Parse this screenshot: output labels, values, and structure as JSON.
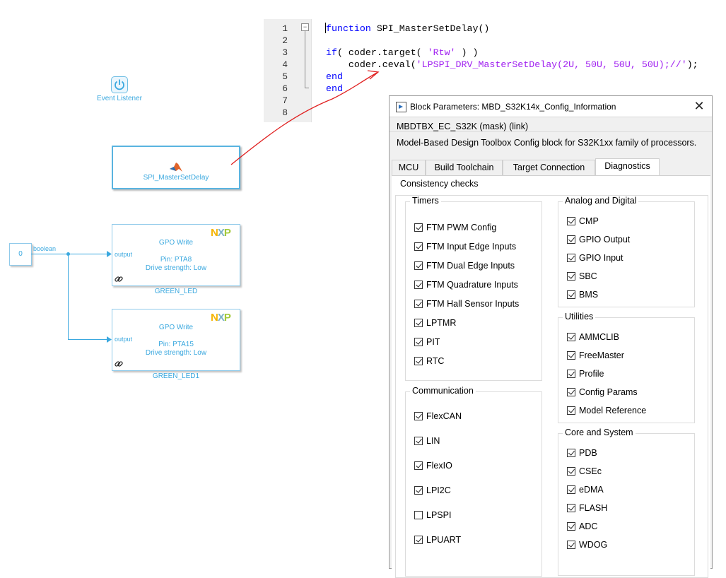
{
  "code_editor": {
    "line_numbers": [
      "1",
      "2",
      "3",
      "4",
      "5",
      "6",
      "7",
      "8"
    ],
    "fold_marker": "−",
    "line1_kw": "function",
    "line1_rest": " SPI_MasterSetDelay()",
    "line3_kw": "if",
    "line3_a": "( coder.target( ",
    "line3_str": "'Rtw'",
    "line3_b": " ) )",
    "line4_a": "    coder.ceval(",
    "line4_str": "'LPSPI_DRV_MasterSetDelay(2U, 50U, 50U, 50U);//'",
    "line4_b": ");",
    "line5_kw": "end",
    "line6_kw": "end"
  },
  "canvas": {
    "event_listener_label": "Event Listener",
    "matlab_block_label": "SPI_MasterSetDelay",
    "constant_value": "0",
    "signal_label": "boolean",
    "gpo_blocks": [
      {
        "title": "GPO Write",
        "pin": "Pin: PTA8",
        "drive": "Drive strength: Low",
        "port": "output",
        "name": "GREEN_LED"
      },
      {
        "title": "GPO Write",
        "pin": "Pin: PTA15",
        "drive": "Drive strength: Low",
        "port": "output",
        "name": "GREEN_LED1"
      }
    ],
    "nxp_logo": {
      "n": "N",
      "x": "X",
      "p": "P"
    }
  },
  "dialog": {
    "title": "Block Parameters: MBD_S32K14x_Config_Information",
    "close_glyph": "✕",
    "mask_name": "MBDTBX_EC_S32K (mask) (link)",
    "description": "Model-Based Design Toolbox Config block for S32K1xx family of processors.",
    "tabs": [
      "MCU",
      "Build Toolchain",
      "Target Connection",
      "Diagnostics"
    ],
    "active_tab": "Diagnostics",
    "outer_group_label": "Consistency checks",
    "groups": {
      "timers": {
        "label": "Timers",
        "items": [
          {
            "label": "FTM PWM Config",
            "checked": true
          },
          {
            "label": "FTM Input Edge Inputs",
            "checked": true
          },
          {
            "label": "FTM Dual Edge Inputs",
            "checked": true
          },
          {
            "label": "FTM Quadrature Inputs",
            "checked": true
          },
          {
            "label": "FTM Hall Sensor Inputs",
            "checked": true
          },
          {
            "label": "LPTMR",
            "checked": true
          },
          {
            "label": "PIT",
            "checked": true
          },
          {
            "label": "RTC",
            "checked": true
          }
        ]
      },
      "communication": {
        "label": "Communication",
        "items": [
          {
            "label": "FlexCAN",
            "checked": true
          },
          {
            "label": "LIN",
            "checked": true
          },
          {
            "label": "FlexIO",
            "checked": true
          },
          {
            "label": "LPI2C",
            "checked": true
          },
          {
            "label": "LPSPI",
            "checked": false
          },
          {
            "label": "LPUART",
            "checked": true
          }
        ]
      },
      "analog": {
        "label": "Analog and Digital",
        "items": [
          {
            "label": "CMP",
            "checked": true
          },
          {
            "label": "GPIO Output",
            "checked": true
          },
          {
            "label": "GPIO Input",
            "checked": true
          },
          {
            "label": "SBC",
            "checked": true
          },
          {
            "label": "BMS",
            "checked": true
          }
        ]
      },
      "utilities": {
        "label": "Utilities",
        "items": [
          {
            "label": "AMMCLIB",
            "checked": true
          },
          {
            "label": "FreeMaster",
            "checked": true
          },
          {
            "label": "Profile",
            "checked": true
          },
          {
            "label": "Config Params",
            "checked": true
          },
          {
            "label": "Model Reference",
            "checked": true
          }
        ]
      },
      "core": {
        "label": "Core and System",
        "items": [
          {
            "label": "PDB",
            "checked": true
          },
          {
            "label": "CSEc",
            "checked": true
          },
          {
            "label": "eDMA",
            "checked": true
          },
          {
            "label": "FLASH",
            "checked": true
          },
          {
            "label": "ADC",
            "checked": true
          },
          {
            "label": "WDOG",
            "checked": true
          }
        ]
      }
    }
  },
  "colors": {
    "annotation_red": "#e02020",
    "simulink_blue": "#3aa8df",
    "code_keyword": "#0000ff",
    "code_string": "#a020f0"
  }
}
